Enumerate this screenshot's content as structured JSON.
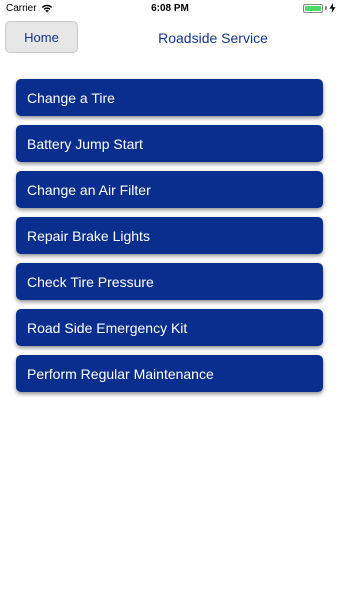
{
  "status_bar": {
    "carrier": "Carrier",
    "time": "6:08 PM",
    "battery_color": "#4cd964"
  },
  "nav": {
    "home_label": "Home",
    "title": "Roadside Service"
  },
  "menu": {
    "items": [
      {
        "label": "Change a Tire"
      },
      {
        "label": "Battery Jump Start"
      },
      {
        "label": "Change an Air Filter"
      },
      {
        "label": "Repair Brake Lights"
      },
      {
        "label": "Check Tire Pressure"
      },
      {
        "label": "Road Side Emergency Kit"
      },
      {
        "label": "Perform Regular Maintenance"
      }
    ]
  },
  "colors": {
    "accent": "#14358f",
    "button_bg": "#0a2e8d",
    "button_text": "#ffffff"
  }
}
